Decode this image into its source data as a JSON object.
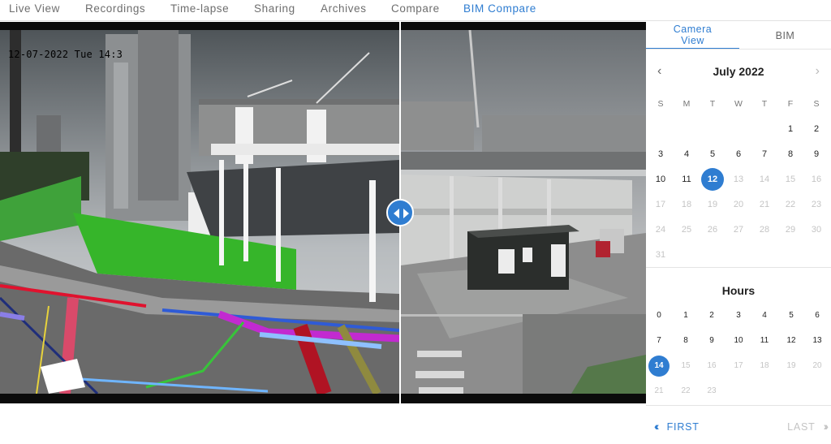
{
  "nav": {
    "tabs": [
      {
        "label": "Live View"
      },
      {
        "label": "Recordings"
      },
      {
        "label": "Time-lapse"
      },
      {
        "label": "Sharing"
      },
      {
        "label": "Archives"
      },
      {
        "label": "Compare"
      },
      {
        "label": "BIM Compare"
      }
    ],
    "active_tab": "BIM Compare"
  },
  "viewer": {
    "timestamp": "12-07-2022 Tue 14:3"
  },
  "side": {
    "tabs": {
      "camera_line1": "Camera",
      "camera_line2": "View",
      "bim": "BIM"
    },
    "active_tab": "Camera View",
    "calendar": {
      "title": "July 2022",
      "prev_icon": "chevron-left-icon",
      "next_icon": "chevron-right-icon",
      "weekdays": [
        "S",
        "M",
        "T",
        "W",
        "T",
        "F",
        "S"
      ],
      "start_weekday_index": 5,
      "days_in_month": 31,
      "last_available_day": 12,
      "selected_day": 12,
      "days": [
        "1",
        "2",
        "3",
        "4",
        "5",
        "6",
        "7",
        "8",
        "9",
        "10",
        "11",
        "12",
        "13",
        "14",
        "15",
        "16",
        "17",
        "18",
        "19",
        "20",
        "21",
        "22",
        "23",
        "24",
        "25",
        "26",
        "27",
        "28",
        "29",
        "30",
        "31"
      ]
    },
    "hours": {
      "title": "Hours",
      "values": [
        "0",
        "1",
        "2",
        "3",
        "4",
        "5",
        "6",
        "7",
        "8",
        "9",
        "10",
        "11",
        "12",
        "13",
        "14",
        "15",
        "16",
        "17",
        "18",
        "19",
        "20",
        "21",
        "22",
        "23"
      ],
      "last_available_hour": 14,
      "selected_hour": 14
    },
    "pager": {
      "first": "FIRST",
      "last": "LAST",
      "first_icon": "double-chevron-left-icon",
      "last_icon": "double-chevron-right-icon"
    }
  },
  "colors": {
    "accent": "#2f7dd1",
    "disabled": "#c4c4c4"
  }
}
